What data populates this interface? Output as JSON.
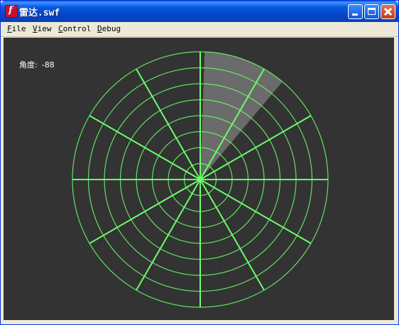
{
  "window": {
    "title": "雷达.swf",
    "app_icon_glyph": "f",
    "buttons": [
      "minimize",
      "maximize",
      "close"
    ]
  },
  "menu": {
    "items": [
      {
        "accel": "F",
        "rest": "ile"
      },
      {
        "accel": "V",
        "rest": "iew"
      },
      {
        "accel": "C",
        "rest": "ontrol"
      },
      {
        "accel": "D",
        "rest": "ebug"
      }
    ]
  },
  "stage": {
    "background": "#333333",
    "angle_label": "角度:",
    "angle_value": "-88"
  },
  "radar": {
    "ring_count": 8,
    "spoke_count": 12,
    "grid_color": "#6bff6b",
    "sweep_color": "#ffffff",
    "sweep_start_deg": -88,
    "sweep_end_deg": -50
  }
}
